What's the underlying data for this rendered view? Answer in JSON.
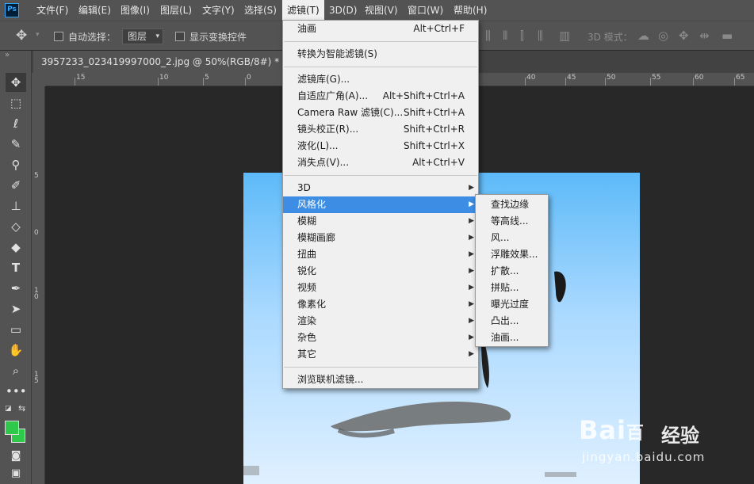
{
  "app": {
    "logo": "Ps"
  },
  "menubar": {
    "items": [
      "文件(F)",
      "编辑(E)",
      "图像(I)",
      "图层(L)",
      "文字(Y)",
      "选择(S)",
      "滤镜(T)",
      "3D(D)",
      "视图(V)",
      "窗口(W)",
      "帮助(H)"
    ],
    "active": "滤镜(T)"
  },
  "options_bar": {
    "move_icon": "move-icon",
    "auto_select_label": "自动选择：",
    "auto_select_checked": false,
    "target_select_value": "图层",
    "show_transform_label": "显示变换控件",
    "show_transform_checked": false,
    "mode_3d_label": "3D 模式："
  },
  "document": {
    "tab_title": "3957233_023419997000_2.jpg @ 50%(RGB/8#) *",
    "close_glyph": "×"
  },
  "ruler": {
    "top_labels": [
      "15",
      "10",
      "5",
      "0",
      "5",
      "10",
      "15",
      "20",
      "25",
      "30",
      "35",
      "40",
      "45",
      "50",
      "55",
      "60",
      "65",
      "70",
      "75"
    ],
    "left_labels": [
      "5",
      "0",
      "5",
      "1\n0",
      "1\n5"
    ]
  },
  "tools": [
    "move",
    "marquee",
    "lasso",
    "quick-select",
    "eyedropper",
    "brush",
    "stamp",
    "eraser",
    "paint-bucket",
    "type",
    "pen",
    "path-select",
    "rectangle",
    "hand",
    "zoom",
    "more"
  ],
  "colors": {
    "foreground": "#2ec84a",
    "background": "#2ec84a",
    "accent": "#3c8de3"
  },
  "filter_menu": {
    "items": [
      {
        "label": "油画",
        "shortcut": "Alt+Ctrl+F"
      },
      {
        "label": "转换为智能滤镜(S)",
        "shortcut": ""
      },
      {
        "label": "滤镜库(G)...",
        "shortcut": ""
      },
      {
        "label": "自适应广角(A)...",
        "shortcut": "Alt+Shift+Ctrl+A"
      },
      {
        "label": "Camera Raw 滤镜(C)...",
        "shortcut": "Shift+Ctrl+A"
      },
      {
        "label": "镜头校正(R)...",
        "shortcut": "Shift+Ctrl+R"
      },
      {
        "label": "液化(L)...",
        "shortcut": "Shift+Ctrl+X"
      },
      {
        "label": "消失点(V)...",
        "shortcut": "Alt+Ctrl+V"
      },
      {
        "label": "3D",
        "submenu": true
      },
      {
        "label": "风格化",
        "submenu": true,
        "highlighted": true
      },
      {
        "label": "模糊",
        "submenu": true
      },
      {
        "label": "模糊画廊",
        "submenu": true
      },
      {
        "label": "扭曲",
        "submenu": true
      },
      {
        "label": "锐化",
        "submenu": true
      },
      {
        "label": "视频",
        "submenu": true
      },
      {
        "label": "像素化",
        "submenu": true
      },
      {
        "label": "渲染",
        "submenu": true
      },
      {
        "label": "杂色",
        "submenu": true
      },
      {
        "label": "其它",
        "submenu": true
      },
      {
        "label": "浏览联机滤镜...",
        "shortcut": ""
      }
    ]
  },
  "stylize_submenu": {
    "items": [
      "查找边缘",
      "等高线...",
      "风...",
      "浮雕效果...",
      "扩散...",
      "拼贴...",
      "曝光过度",
      "凸出...",
      "油画..."
    ]
  },
  "watermark": {
    "logo_text": "Bai",
    "logo_suffix": "百",
    "brand": "经验",
    "url": "jingyan.baidu.com"
  }
}
